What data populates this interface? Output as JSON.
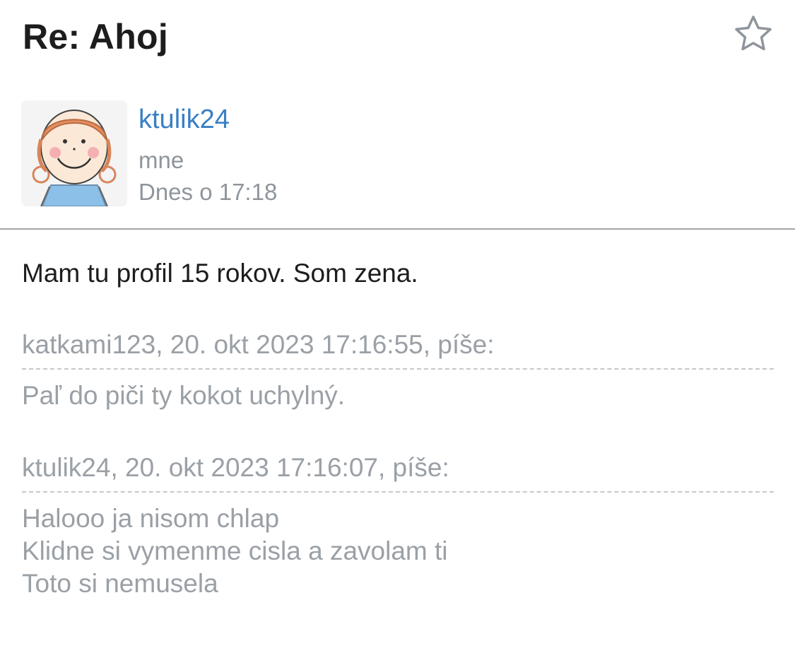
{
  "message": {
    "subject": "Re: Ahoj",
    "star_icon": "star-outline-icon",
    "sender": {
      "name": "ktulik24",
      "avatar": "cartoon-girl-avatar",
      "recipient": "mne",
      "date": "Dnes o 17:18"
    },
    "body": "Mam tu profil 15 rokov. Som zena.",
    "quotes": [
      {
        "header": "katkami123, 20. okt 2023 17:16:55, píše:",
        "lines": [
          "Paľ do piči ty kokot uchylný."
        ]
      },
      {
        "header": "ktulik24, 20. okt 2023 17:16:07, píše:",
        "lines": [
          "Halooo ja nisom chlap",
          "Klidne si vymenme cisla a zavolam ti",
          "Toto si nemusela"
        ]
      }
    ]
  },
  "colors": {
    "sender_link": "#3a7fc4",
    "muted_text": "#9aa0a6",
    "divider": "#a3a6aa"
  }
}
